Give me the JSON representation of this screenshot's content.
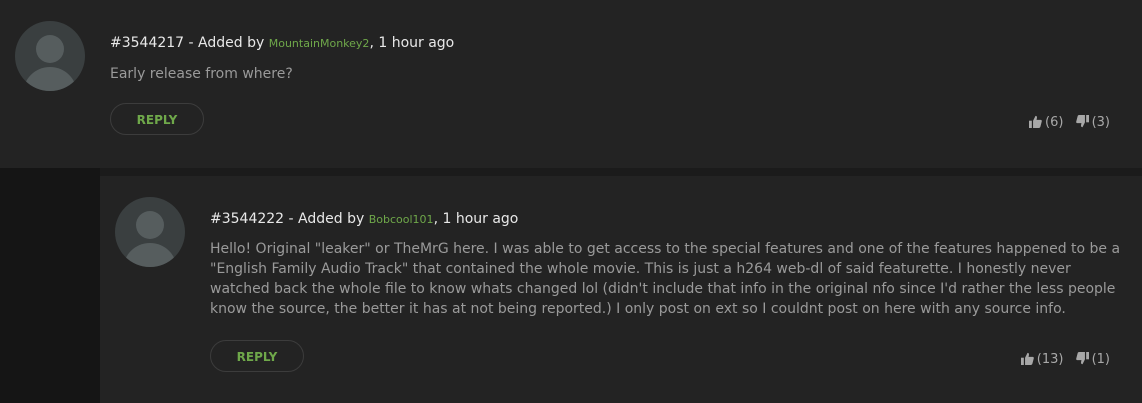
{
  "comments": [
    {
      "id": "#3544217",
      "added_by_label": " - Added by ",
      "user": "MountainMonkey2",
      "time": ", 1 hour ago",
      "text": "Early release from where?",
      "reply_label": "REPLY",
      "upvotes": "(6)",
      "downvotes": "(3)",
      "icons": {
        "avatar": "default-user-avatar",
        "up": "thumbs-up-icon",
        "down": "thumbs-down-icon"
      }
    },
    {
      "id": "#3544222",
      "added_by_label": " - Added by ",
      "user": "Bobcool101",
      "time": ", 1 hour ago",
      "text": "Hello! Original \"leaker\" or TheMrG here. I was able to get access to the special features and one of the features happened to be a \"English Family Audio Track\" that contained the whole movie. This is just a h264 web-dl of said featurette. I honestly never watched back the whole file to know whats changed lol (didn't include that info in the original nfo since I'd rather the less people know the source, the better it has at not being reported.) I only post on ext so I couldnt post on here with any source info.",
      "reply_label": "REPLY",
      "upvotes": "(13)",
      "downvotes": "(1)",
      "icons": {
        "avatar": "default-user-avatar",
        "up": "thumbs-up-icon",
        "down": "thumbs-down-icon"
      }
    }
  ],
  "colors": {
    "username": "#6fa84a",
    "reply_text": "#6fa84a",
    "comment_bg": "#232323",
    "body_text": "#9a9a9a"
  }
}
